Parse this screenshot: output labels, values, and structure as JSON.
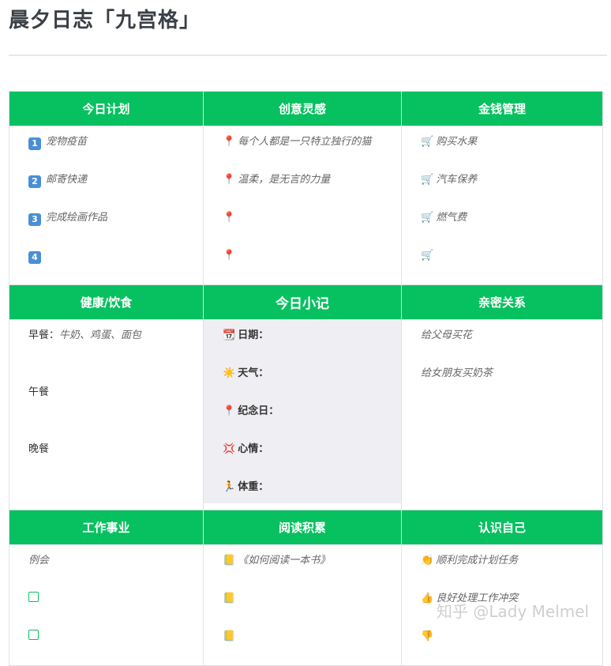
{
  "title": "晨夕日志「九宫格」",
  "headers": {
    "plan": "今日计划",
    "inspiration": "创意灵感",
    "money": "金钱管理",
    "health": "健康/饮食",
    "notes": "今日小记",
    "family": "亲密关系",
    "work": "工作事业",
    "reading": "阅读积累",
    "self": "认识自己"
  },
  "plan": {
    "badges": [
      "1",
      "2",
      "3",
      "4"
    ],
    "items": [
      "宠物疫苗",
      "邮寄快递",
      "完成绘画作品",
      ""
    ]
  },
  "inspiration": {
    "icon": "📍",
    "items": [
      "每个人都是一只特立独行的猫",
      "温柔，是无言的力量",
      "",
      ""
    ]
  },
  "money": {
    "icon": "🛒",
    "items": [
      "购买水果",
      "汽车保养",
      "燃气费",
      ""
    ]
  },
  "health": {
    "breakfast_label": "早餐：",
    "breakfast_value": "牛奶、鸡蛋、面包",
    "lunch_label": "午餐",
    "dinner_label": "晚餐"
  },
  "notes": {
    "date": {
      "icon": "📆",
      "label": "日期："
    },
    "weather": {
      "icon": "☀️",
      "label": "天气："
    },
    "anniversary": {
      "icon": "📍",
      "label": "纪念日："
    },
    "mood": {
      "icon": "💢",
      "label": "心情："
    },
    "weight": {
      "icon": "🏃",
      "label": "体重："
    }
  },
  "family": {
    "items": [
      "给父母买花",
      "给女朋友买奶茶"
    ]
  },
  "work": {
    "item": "例会"
  },
  "reading": {
    "icon": "📒",
    "items": [
      "《如何阅读一本书》",
      "",
      ""
    ]
  },
  "self": {
    "items": [
      {
        "icon": "👏",
        "text": "顺利完成计划任务"
      },
      {
        "icon": "👍",
        "text": "良好处理工作冲突"
      },
      {
        "icon": "👎",
        "text": ""
      }
    ]
  },
  "watermark": "知乎 @Lady Melmel"
}
